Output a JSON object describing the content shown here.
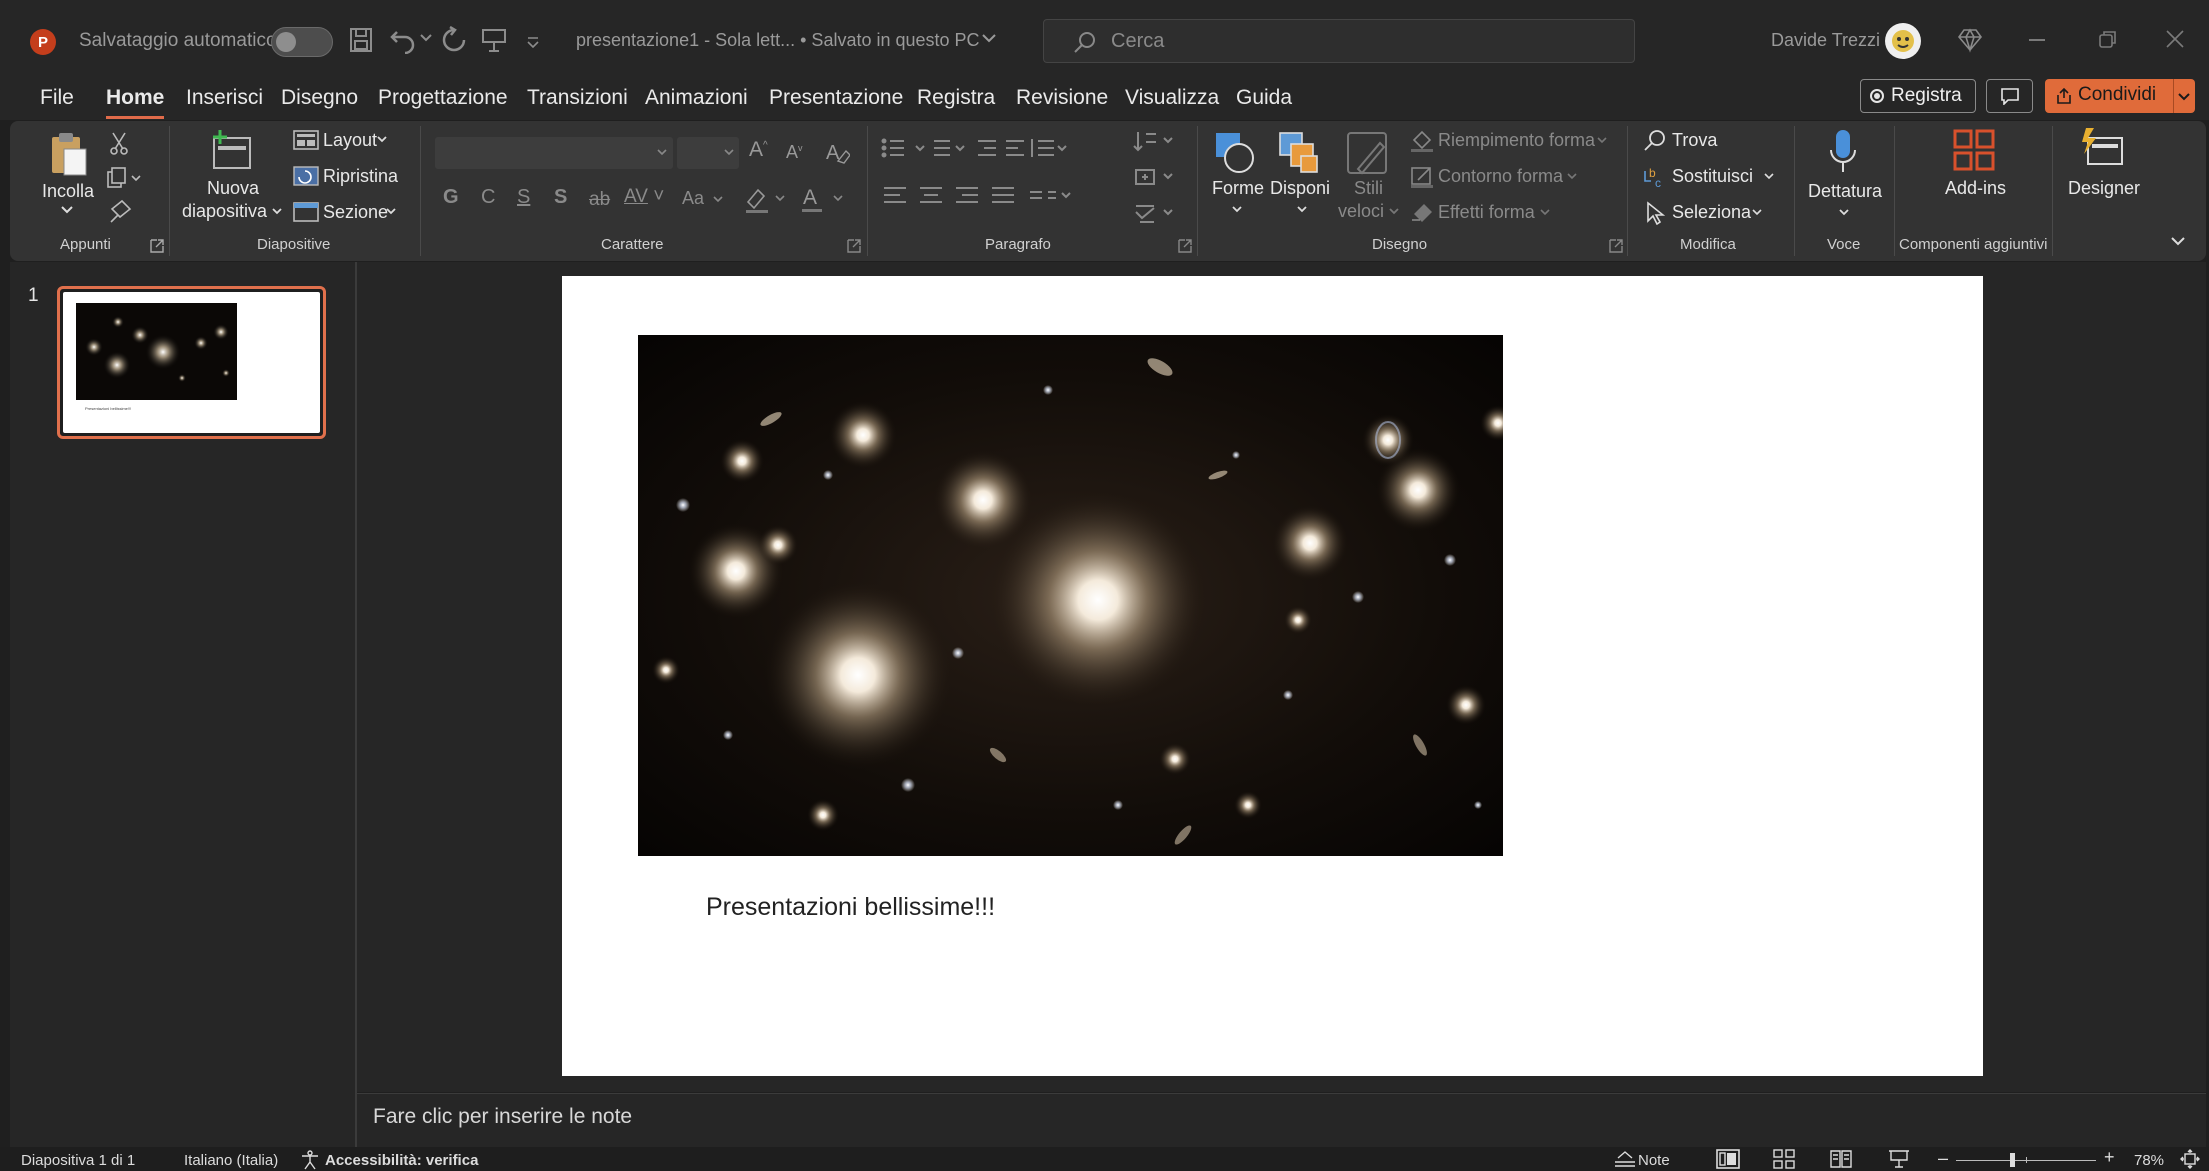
{
  "titlebar": {
    "autosave_label": "Salvataggio automatico",
    "doc_title": "presentazione1  -  Sola lett...  •  Salvato in questo PC",
    "search_placeholder": "Cerca",
    "user_name": "Davide Trezzi",
    "accent": "#c43e1c"
  },
  "menu": {
    "tabs": [
      "File",
      "Home",
      "Inserisci",
      "Disegno",
      "Progettazione",
      "Transizioni",
      "Animazioni",
      "Presentazione",
      "Registra",
      "Revisione",
      "Visualizza",
      "Guida"
    ],
    "active": "Home",
    "record_label": "Registra",
    "share_label": "Condividi",
    "share_color": "#e06b3a"
  },
  "ribbon": {
    "clipboard": {
      "paste": "Incolla",
      "group": "Appunti"
    },
    "slides": {
      "new_slide_1": "Nuova",
      "new_slide_2": "diapositiva",
      "layout": "Layout",
      "reset": "Ripristina",
      "section": "Sezione",
      "group": "Diapositive"
    },
    "font": {
      "bold": "G",
      "italic": "C",
      "underline": "S",
      "shadow": "S",
      "case": "Aa",
      "group": "Carattere"
    },
    "paragraph": {
      "group": "Paragrafo"
    },
    "drawing": {
      "shapes": "Forme",
      "arrange": "Disponi",
      "quick_styles_1": "Stili",
      "quick_styles_2": "veloci",
      "fill": "Riempimento forma",
      "outline": "Contorno forma",
      "effects": "Effetti forma",
      "group": "Disegno"
    },
    "editing": {
      "find": "Trova",
      "replace": "Sostituisci",
      "select": "Seleziona",
      "group": "Modifica"
    },
    "voice": {
      "dictate": "Dettatura",
      "group": "Voce"
    },
    "addins": {
      "label": "Add-ins",
      "group": "Componenti aggiuntivi"
    },
    "designer": {
      "label": "Designer"
    }
  },
  "thumbnails": [
    {
      "number": "1",
      "caption": "Presentazioni bellissime!!!"
    }
  ],
  "slide": {
    "caption": "Presentazioni bellissime!!!"
  },
  "notes": {
    "placeholder": "Fare clic per inserire le note"
  },
  "status": {
    "slide_counter": "Diapositiva 1 di 1",
    "language": "Italiano (Italia)",
    "accessibility": "Accessibilità: verifica",
    "notes_button": "Note",
    "zoom": "78%"
  }
}
